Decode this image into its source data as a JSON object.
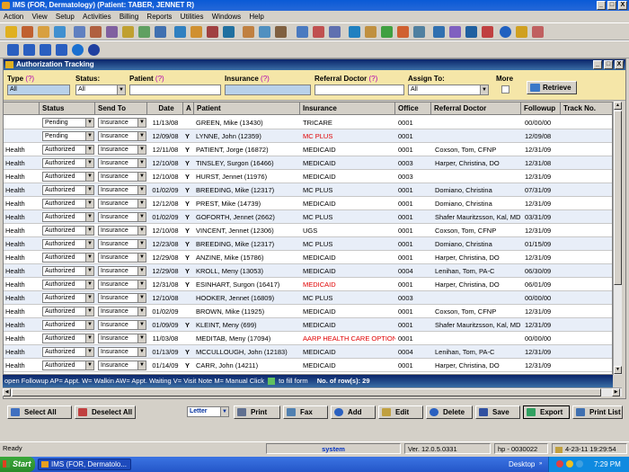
{
  "app_title": "IMS (FOR, Dermatology)   (Patient: TABER, JENNET R)",
  "window_buttons": {
    "min": "_",
    "max": "□",
    "close": "X"
  },
  "menu": [
    "Action",
    "View",
    "Setup",
    "Activities",
    "Billing",
    "Reports",
    "Utilities",
    "Windows",
    "Help"
  ],
  "inner_title": "Authorization Tracking",
  "filters": {
    "type_label": "Type",
    "type_value": "All",
    "status_label": "Status:",
    "status_value": "All",
    "patient_label": "Patient",
    "patient_value": "",
    "insurance_label": "Insurance",
    "insurance_value": "",
    "referral_label": "Referral Doctor",
    "referral_value": "",
    "assign_label": "Assign To:",
    "assign_value": "All",
    "more_label": "More",
    "q": "(?)",
    "retrieve_label": "Retrieve"
  },
  "columns": [
    "Status",
    "Send To",
    "Date",
    "A",
    "Patient",
    "Insurance",
    "Office",
    "Referral Doctor",
    "Followup",
    "Track No."
  ],
  "rows": [
    {
      "type": "",
      "status": "Pending",
      "send_to": "Insurance",
      "date": "11/13/08",
      "a": "",
      "patient": "GREEN, Mike  (13430)",
      "insurance": "TRICARE",
      "ins_red": false,
      "office": "0001",
      "referral": "",
      "followup": "00/00/00"
    },
    {
      "type": "",
      "status": "Pending",
      "send_to": "Insurance",
      "date": "12/09/08",
      "a": "Y",
      "patient": "LYNNE, John  (12359)",
      "insurance": "MC PLUS",
      "ins_red": true,
      "office": "0001",
      "referral": "",
      "followup": "12/09/08"
    },
    {
      "type": "Health",
      "status": "Authorized",
      "send_to": "Insurance",
      "date": "12/11/08",
      "a": "Y",
      "patient": "PATIENT, Jorge  (16872)",
      "insurance": "MEDICAID",
      "ins_red": false,
      "office": "0001",
      "referral": "Coxson, Tom, CFNP",
      "followup": "12/31/09"
    },
    {
      "type": "Health",
      "status": "Authorized",
      "send_to": "Insurance",
      "date": "12/10/08",
      "a": "Y",
      "patient": "TINSLEY, Surgon  (16466)",
      "insurance": "MEDICAID",
      "ins_red": false,
      "office": "0003",
      "referral": "Harper, Christina, DO",
      "followup": "12/31/08"
    },
    {
      "type": "Health",
      "status": "Authorized",
      "send_to": "Insurance",
      "date": "12/10/08",
      "a": "Y",
      "patient": "HURST, Jennet  (11976)",
      "insurance": "MEDICAID",
      "ins_red": false,
      "office": "0003",
      "referral": "",
      "followup": "12/31/09"
    },
    {
      "type": "Health",
      "status": "Authorized",
      "send_to": "Insurance",
      "date": "01/02/09",
      "a": "Y",
      "patient": "BREEDING, Mike  (12317)",
      "insurance": "MC PLUS",
      "ins_red": false,
      "office": "0001",
      "referral": "Domiano, Christina",
      "followup": "07/31/09"
    },
    {
      "type": "Health",
      "status": "Authorized",
      "send_to": "Insurance",
      "date": "12/12/08",
      "a": "Y",
      "patient": "PREST, Mike  (14739)",
      "insurance": "MEDICAID",
      "ins_red": false,
      "office": "0001",
      "referral": "Domiano, Christina",
      "followup": "12/31/09"
    },
    {
      "type": "Health",
      "status": "Authorized",
      "send_to": "Insurance",
      "date": "01/02/09",
      "a": "Y",
      "patient": "GOFORTH, Jennet  (2662)",
      "insurance": "MC PLUS",
      "ins_red": false,
      "office": "0001",
      "referral": "Shafer Mauritzsson, Kal, MD",
      "followup": "03/31/09"
    },
    {
      "type": "Health",
      "status": "Authorized",
      "send_to": "Insurance",
      "date": "12/10/08",
      "a": "Y",
      "patient": "VINCENT, Jennet  (12306)",
      "insurance": "UGS",
      "ins_red": false,
      "office": "0001",
      "referral": "Coxson, Tom, CFNP",
      "followup": "12/31/09"
    },
    {
      "type": "Health",
      "status": "Authorized",
      "send_to": "Insurance",
      "date": "12/23/08",
      "a": "Y",
      "patient": "BREEDING, Mike  (12317)",
      "insurance": "MC PLUS",
      "ins_red": false,
      "office": "0001",
      "referral": "Domiano, Christina",
      "followup": "01/15/09"
    },
    {
      "type": "Health",
      "status": "Authorized",
      "send_to": "Insurance",
      "date": "12/29/08",
      "a": "Y",
      "patient": "ANZINE, Mike  (15786)",
      "insurance": "MEDICAID",
      "ins_red": false,
      "office": "0001",
      "referral": "Harper, Christina, DO",
      "followup": "12/31/09"
    },
    {
      "type": "Health",
      "status": "Authorized",
      "send_to": "Insurance",
      "date": "12/29/08",
      "a": "Y",
      "patient": "KROLL, Meny  (13053)",
      "insurance": "MEDICAID",
      "ins_red": false,
      "office": "0004",
      "referral": "Lenihan, Tom, PA-C",
      "followup": "06/30/09"
    },
    {
      "type": "Health",
      "status": "Authorized",
      "send_to": "Insurance",
      "date": "12/31/08",
      "a": "Y",
      "patient": "ESINHART, Surgon  (16417)",
      "insurance": "MEDICAID",
      "ins_red": true,
      "office": "0001",
      "referral": "Harper, Christina, DO",
      "followup": "06/01/09"
    },
    {
      "type": "Health",
      "status": "Authorized",
      "send_to": "Insurance",
      "date": "12/10/08",
      "a": "",
      "patient": "HOOKER, Jennet  (16809)",
      "insurance": "MC PLUS",
      "ins_red": false,
      "office": "0003",
      "referral": "",
      "followup": "00/00/00"
    },
    {
      "type": "Health",
      "status": "Authorized",
      "send_to": "Insurance",
      "date": "01/02/09",
      "a": "",
      "patient": "BROWN, Mike  (11925)",
      "insurance": "MEDICAID",
      "ins_red": false,
      "office": "0001",
      "referral": "Coxson, Tom, CFNP",
      "followup": "12/31/09"
    },
    {
      "type": "Health",
      "status": "Authorized",
      "send_to": "Insurance",
      "date": "01/09/09",
      "a": "Y",
      "patient": "KLEINT, Meny  (699)",
      "insurance": "MEDICAID",
      "ins_red": false,
      "office": "0001",
      "referral": "Shafer Mauritzsson, Kal, MD",
      "followup": "12/31/09"
    },
    {
      "type": "Health",
      "status": "Authorized",
      "send_to": "Insurance",
      "date": "11/03/08",
      "a": "",
      "patient": "MEDITAB, Meny  (17094)",
      "insurance": "AARP HEALTH CARE OPTIONS",
      "ins_red": true,
      "office": "0001",
      "referral": "",
      "followup": "00/00/00"
    },
    {
      "type": "Health",
      "status": "Authorized",
      "send_to": "Insurance",
      "date": "01/13/09",
      "a": "Y",
      "patient": "MCCULLOUGH, John  (12183)",
      "insurance": "MEDICAID",
      "ins_red": false,
      "office": "0004",
      "referral": "Lenihan, Tom, PA-C",
      "followup": "12/31/09"
    },
    {
      "type": "Health",
      "status": "Authorized",
      "send_to": "Insurance",
      "date": "01/14/09",
      "a": "Y",
      "patient": "CARR, John  (14211)",
      "insurance": "MEDICAID",
      "ins_red": false,
      "office": "0001",
      "referral": "Harper, Christina, DO",
      "followup": "12/31/09"
    }
  ],
  "legend_line": "open Followup     AP= Appt. W= Walkin  AW= Appt. Waiting  V= Visit Note  M= Manual    Click",
  "legend_tail": "to fill form",
  "row_count_label": "No. of row(s): 29",
  "buttons": {
    "select_all": "Select All",
    "deselect_all": "Deselect All",
    "letter_value": "Letter",
    "print": "Print",
    "fax": "Fax",
    "add": "Add",
    "edit": "Edit",
    "delete": "Delete",
    "save": "Save",
    "export": "Export",
    "print_list": "Print List"
  },
  "status_bar": {
    "ready": "Ready",
    "user": "system",
    "version": "Ver. 12.0.5.0331",
    "host": "hp - 0030022",
    "datetime": "4-23-11 19:29:54"
  },
  "taskbar": {
    "start": "Start",
    "task": "IMS (FOR, Dermatolo...",
    "desktop": "Desktop",
    "clock": "7:29 PM"
  }
}
